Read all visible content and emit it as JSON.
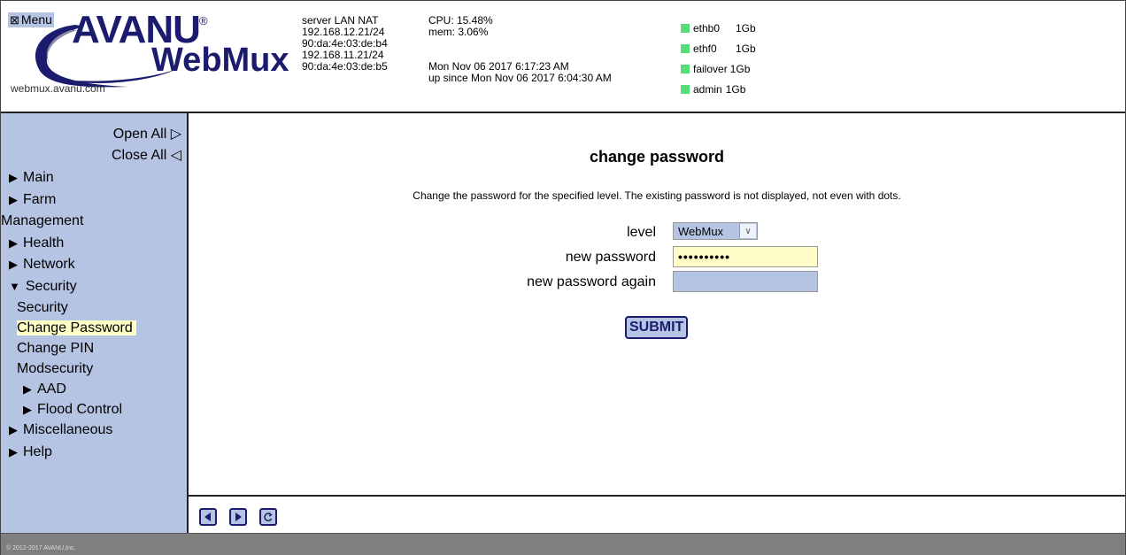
{
  "header": {
    "menu_toggle": "Menu",
    "brand": {
      "name": "AVANU",
      "registered": "®",
      "product": "WebMux"
    },
    "site_url": "webmux.avanu.com",
    "server": {
      "line1": "server LAN NAT",
      "line2": "192.168.12.21/24",
      "line3": "90:da:4e:03:de:b4",
      "line4": "192.168.11.21/24",
      "line5": "90:da:4e:03:de:b5"
    },
    "stats": {
      "cpu": "CPU: 15.48%",
      "mem": "mem: 3.06%",
      "time": "Mon Nov 06 2017 6:17:23 AM",
      "uptime": "up since Mon Nov 06 2017 6:04:30 AM"
    },
    "interfaces": [
      {
        "name": "ethb0",
        "speed": "1Gb"
      },
      {
        "name": "ethf0",
        "speed": "1Gb"
      },
      {
        "name": "failover",
        "speed": "1Gb"
      },
      {
        "name": "admin",
        "speed": "1Gb"
      }
    ],
    "colors": {
      "link_up": "#55dd77",
      "brand": "#1c1c6e"
    }
  },
  "sidebar": {
    "open_all": "Open All ▷",
    "close_all": "Close All ◁",
    "items": {
      "main": "Main",
      "farm": "Farm",
      "farm_cont": "Management",
      "health": "Health",
      "network": "Network",
      "security": "Security",
      "security_sub": "Security",
      "change_password": "Change Password",
      "change_pin": "Change PIN",
      "modsecurity": "Modsecurity",
      "aad": "AAD",
      "flood": "Flood Control",
      "misc": "Miscellaneous",
      "help": "Help"
    },
    "colors": {
      "background": "#b6c4e4",
      "active": "#ffffc6"
    }
  },
  "main": {
    "title": "change password",
    "description": "Change the password for the specified level. The existing password is not displayed, not even with dots.",
    "level_label": "level",
    "level_value": "WebMux",
    "new_password_label": "new password",
    "new_password_value": "••••••••••",
    "new_password_again_label": "new password again",
    "new_password_again_value": "",
    "submit_label": "SUBMIT"
  },
  "footer": {
    "copyright": "© 2012-2017 AVANU,Inc."
  }
}
